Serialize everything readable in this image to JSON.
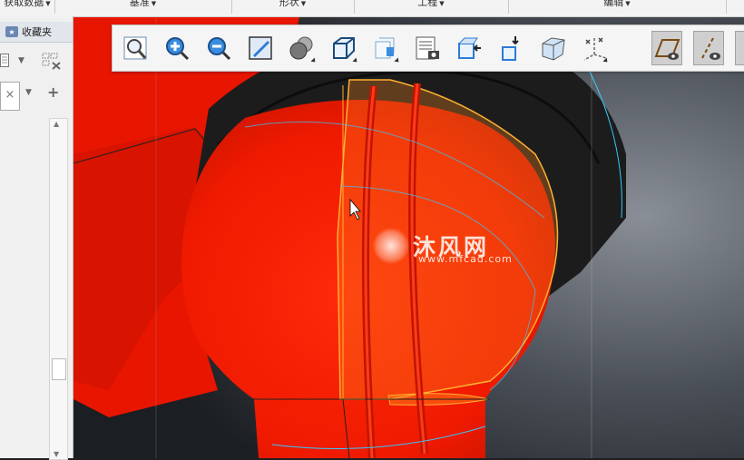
{
  "ribbon": {
    "groups": [
      {
        "label": "获取数据"
      },
      {
        "label": "基准"
      },
      {
        "label": "形状"
      },
      {
        "label": "工程"
      },
      {
        "label": "编辑"
      }
    ]
  },
  "left_panel": {
    "tab_label": "收藏夹",
    "filter_value": "×",
    "add_label": "+"
  },
  "toolbar": {
    "buttons": [
      {
        "icon": "refit-icon"
      },
      {
        "icon": "zoom-in-icon"
      },
      {
        "icon": "zoom-out-icon"
      },
      {
        "icon": "repaint-icon"
      },
      {
        "icon": "display-style-icon"
      },
      {
        "icon": "saved-orientations-icon"
      },
      {
        "icon": "view-manager-icon"
      },
      {
        "icon": "appearance-icon"
      },
      {
        "icon": "section-icon"
      },
      {
        "icon": "explode-icon"
      },
      {
        "icon": "perspective-view-icon"
      },
      {
        "icon": "datum-display-icon"
      },
      {
        "icon": "plane-display-icon",
        "active": true
      },
      {
        "icon": "axis-display-icon",
        "active": true
      }
    ]
  },
  "watermark": {
    "cn": "沐风网",
    "url": "www.mfcad.com"
  },
  "colors": {
    "model_red": "#f21a00",
    "accent_orange": "#ffb030",
    "edge_cyan": "#36c8ff"
  }
}
